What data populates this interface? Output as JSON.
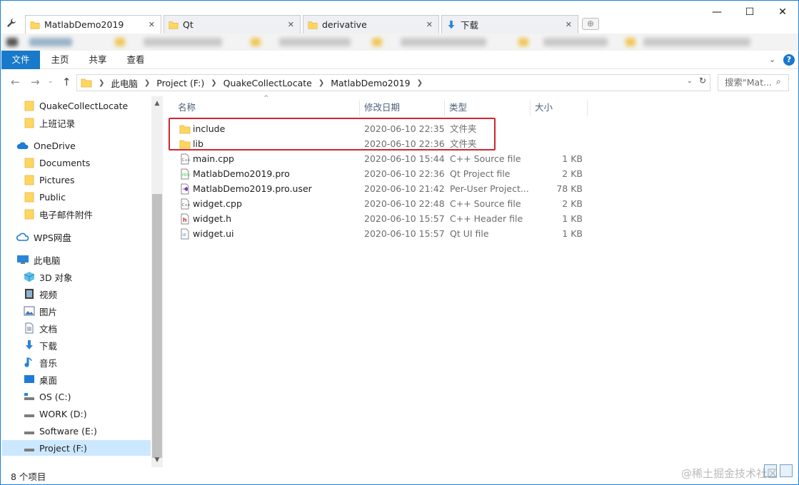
{
  "tabs": [
    {
      "label": "MatlabDemo2019",
      "icon": "folder-icon"
    },
    {
      "label": "Qt",
      "icon": "folder-icon"
    },
    {
      "label": "derivative",
      "icon": "folder-icon"
    },
    {
      "label": "下载",
      "icon": "download-icon"
    }
  ],
  "ribbon": {
    "file": "文件",
    "home": "主页",
    "share": "共享",
    "view": "查看"
  },
  "address": {
    "crumbs": [
      "此电脑",
      "Project (F:)",
      "QuakeCollectLocate",
      "MatlabDemo2019"
    ],
    "search_placeholder": "搜索\"Mat..."
  },
  "nav": {
    "items": [
      {
        "label": "QuakeCollectLocate",
        "icon": "folder-icon"
      },
      {
        "label": "上班记录",
        "icon": "folder-icon"
      },
      {
        "label": "OneDrive",
        "icon": "cloud-icon"
      },
      {
        "label": "Documents",
        "icon": "folder-icon"
      },
      {
        "label": "Pictures",
        "icon": "folder-icon"
      },
      {
        "label": "Public",
        "icon": "folder-icon"
      },
      {
        "label": "电子邮件附件",
        "icon": "folder-icon"
      },
      {
        "label": "WPS网盘",
        "icon": "wps-cloud-icon"
      },
      {
        "label": "此电脑",
        "icon": "computer-icon"
      },
      {
        "label": "3D 对象",
        "icon": "cube-icon"
      },
      {
        "label": "视频",
        "icon": "video-icon"
      },
      {
        "label": "图片",
        "icon": "picture-icon"
      },
      {
        "label": "文档",
        "icon": "document-icon"
      },
      {
        "label": "下载",
        "icon": "download-icon"
      },
      {
        "label": "音乐",
        "icon": "music-icon"
      },
      {
        "label": "桌面",
        "icon": "desktop-icon"
      },
      {
        "label": "OS (C:)",
        "icon": "os-drive-icon"
      },
      {
        "label": "WORK (D:)",
        "icon": "drive-icon"
      },
      {
        "label": "Software (E:)",
        "icon": "drive-icon"
      },
      {
        "label": "Project (F:)",
        "icon": "drive-icon"
      }
    ]
  },
  "columns": {
    "name": "名称",
    "date": "修改日期",
    "type": "类型",
    "size": "大小"
  },
  "files": [
    {
      "name": "include",
      "date": "2020-06-10 22:35",
      "type": "文件夹",
      "size": "",
      "icon": "folder-icon"
    },
    {
      "name": "lib",
      "date": "2020-06-10 22:36",
      "type": "文件夹",
      "size": "",
      "icon": "folder-icon"
    },
    {
      "name": "main.cpp",
      "date": "2020-06-10 15:44",
      "type": "C++ Source file",
      "size": "1 KB",
      "icon": "cpp-file-icon"
    },
    {
      "name": "MatlabDemo2019.pro",
      "date": "2020-06-10 22:36",
      "type": "Qt Project file",
      "size": "2 KB",
      "icon": "qt-project-file-icon"
    },
    {
      "name": "MatlabDemo2019.pro.user",
      "date": "2020-06-10 21:42",
      "type": "Per-User Project...",
      "size": "78 KB",
      "icon": "vs-user-file-icon"
    },
    {
      "name": "widget.cpp",
      "date": "2020-06-10 22:48",
      "type": "C++ Source file",
      "size": "2 KB",
      "icon": "cpp-file-icon"
    },
    {
      "name": "widget.h",
      "date": "2020-06-10 15:57",
      "type": "C++ Header file",
      "size": "1 KB",
      "icon": "header-file-icon"
    },
    {
      "name": "widget.ui",
      "date": "2020-06-10 15:57",
      "type": "Qt UI file",
      "size": "1 KB",
      "icon": "ui-file-icon"
    }
  ],
  "status": {
    "count": "8 个项目"
  },
  "watermark": "@稀土掘金技术社区",
  "colors": {
    "accent": "#1979ca",
    "highlight": "#d3242f",
    "folder": "#ffd660"
  }
}
